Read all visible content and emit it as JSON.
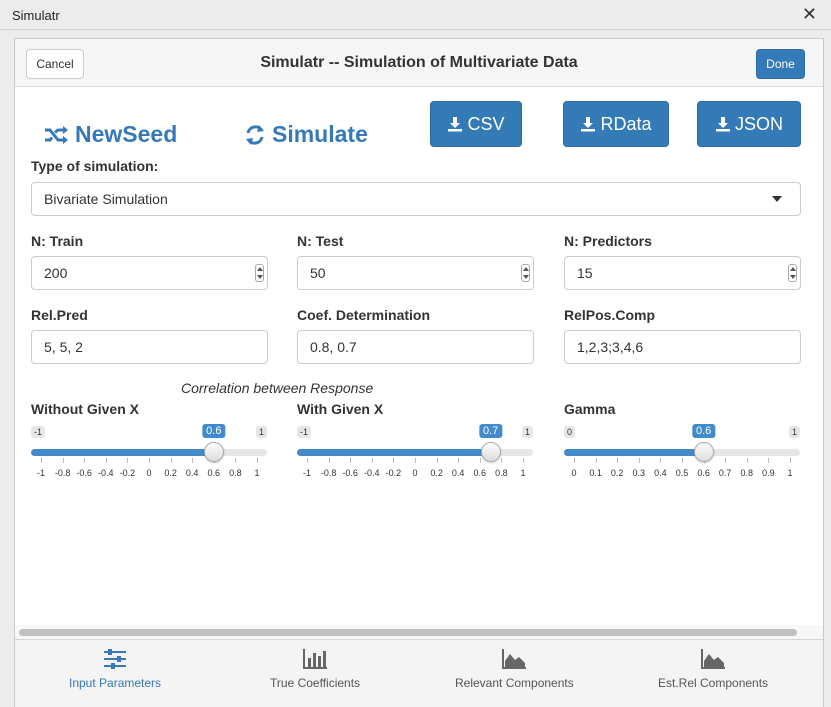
{
  "window": {
    "title": "Simulatr",
    "close_glyph": "✕"
  },
  "header": {
    "cancel_label": "Cancel",
    "title": "Simulatr -- Simulation of Multivariate Data",
    "done_label": "Done"
  },
  "actions": {
    "newseed_label": "NewSeed",
    "newseed_icon": "shuffle-icon",
    "simulate_label": "Simulate",
    "simulate_icon": "refresh-icon",
    "csv_label": "CSV",
    "rdata_label": "RData",
    "json_label": "JSON",
    "download_icon": "download-icon"
  },
  "sim_type": {
    "label": "Type of simulation:",
    "value": "Bivariate Simulation"
  },
  "fields": {
    "n_train": {
      "label": "N: Train",
      "value": "200"
    },
    "n_test": {
      "label": "N: Test",
      "value": "50"
    },
    "n_predictors": {
      "label": "N: Predictors",
      "value": "15"
    },
    "rel_pred": {
      "label": "Rel.Pred",
      "value": "5, 5, 2"
    },
    "coef_det": {
      "label": "Coef. Determination",
      "value": "0.8, 0.7"
    },
    "relpos_comp": {
      "label": "RelPos.Comp",
      "value": "1,2,3;3,4,6"
    }
  },
  "correlation_title": "Correlation between Response",
  "sliders": {
    "without_x": {
      "label": "Without Given X",
      "min": "-1",
      "max": "1",
      "value": 0.6,
      "value_label": "0.6",
      "range": [
        -1,
        1
      ],
      "ticks": [
        "-1",
        "-0.8",
        "-0.6",
        "-0.4",
        "-0.2",
        "0",
        "0.2",
        "0.4",
        "0.6",
        "0.8",
        "1"
      ]
    },
    "with_x": {
      "label": "With Given X",
      "min": "-1",
      "max": "1",
      "value": 0.7,
      "value_label": "0.7",
      "range": [
        -1,
        1
      ],
      "ticks": [
        "-1",
        "-0.8",
        "-0.6",
        "-0.4",
        "-0.2",
        "0",
        "0.2",
        "0.4",
        "0.6",
        "0.8",
        "1"
      ]
    },
    "gamma": {
      "label": "Gamma",
      "min": "0",
      "max": "1",
      "value": 0.6,
      "value_label": "0.6",
      "range": [
        0,
        1
      ],
      "ticks": [
        "0",
        "0.1",
        "0.2",
        "0.3",
        "0.4",
        "0.5",
        "0.6",
        "0.7",
        "0.8",
        "0.9",
        "1"
      ]
    }
  },
  "tabs": [
    {
      "label": "Input Parameters",
      "icon": "sliders-icon",
      "active": true
    },
    {
      "label": "True Coefficients",
      "icon": "bar-chart-icon",
      "active": false
    },
    {
      "label": "Relevant Components",
      "icon": "area-chart-icon",
      "active": false
    },
    {
      "label": "Est.Rel Components",
      "icon": "area-chart-icon",
      "active": false
    }
  ],
  "colors": {
    "accent": "#337ab7",
    "link": "#3579b8",
    "slider_fill": "#428bca"
  }
}
